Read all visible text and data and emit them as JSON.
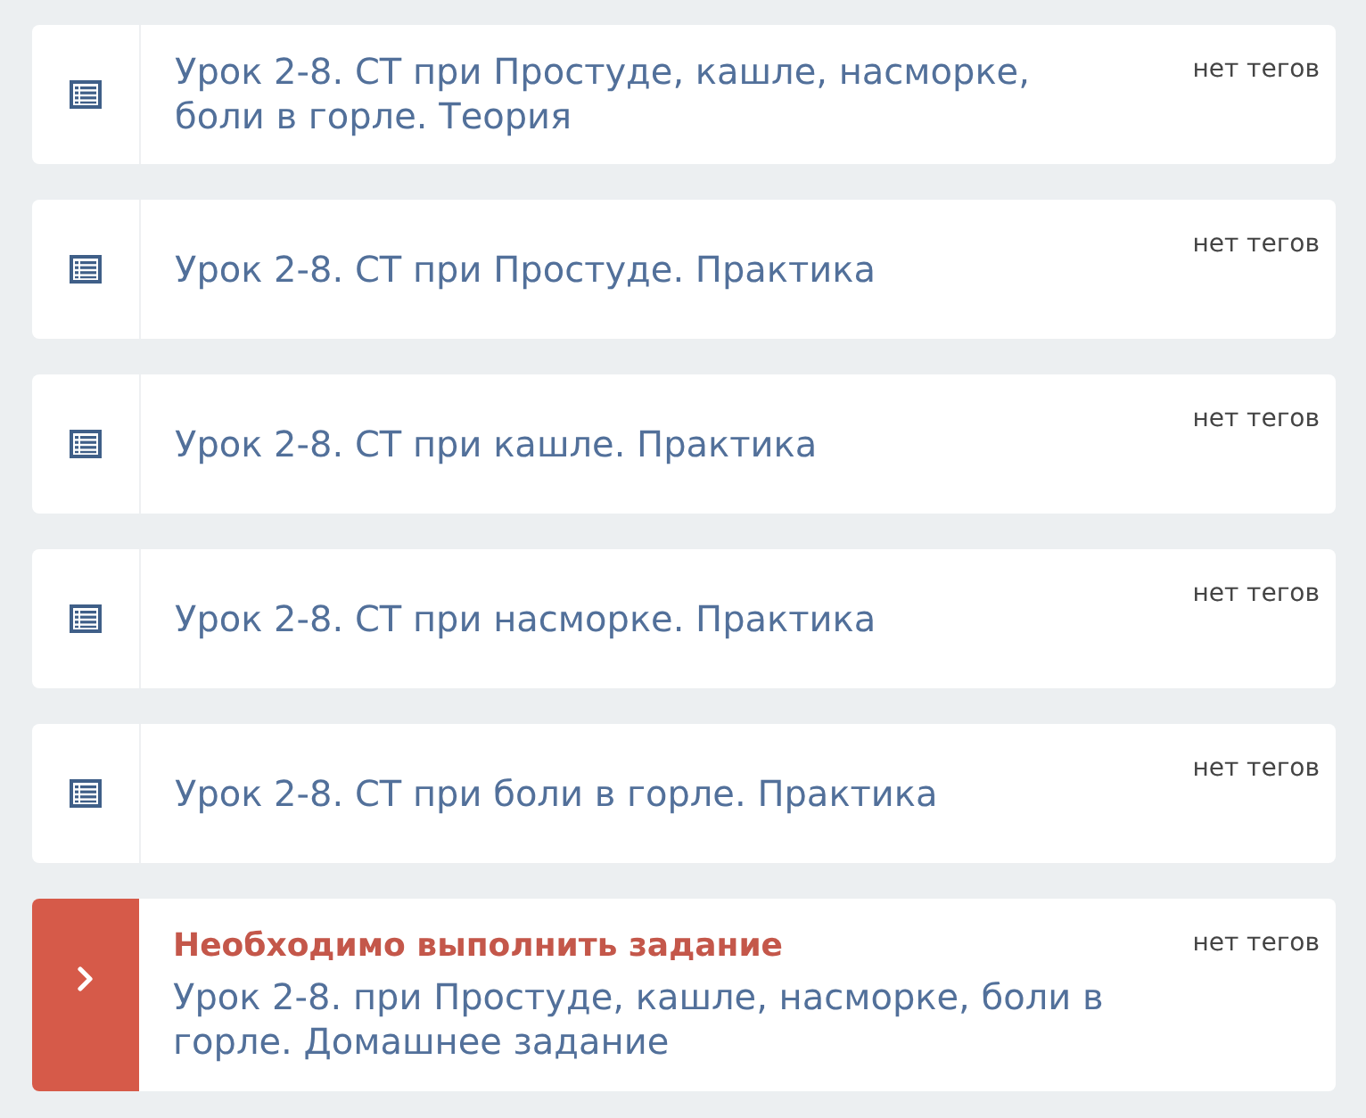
{
  "lessons": [
    {
      "kind": "lesson",
      "title": "Урок 2-8. СТ при Простуде, кашле, насморке, боли в горле. Теория",
      "tags": "нет тегов"
    },
    {
      "kind": "lesson",
      "title": "Урок 2-8. СТ при Простуде. Практика",
      "tags": "нет тегов"
    },
    {
      "kind": "lesson",
      "title": "Урок 2-8. СТ при кашле. Практика",
      "tags": "нет тегов"
    },
    {
      "kind": "lesson",
      "title": "Урок 2-8. СТ при насморке. Практика",
      "tags": "нет тегов"
    },
    {
      "kind": "lesson",
      "title": "Урок 2-8. СТ при боли в горле. Практика",
      "tags": "нет тегов"
    },
    {
      "kind": "assignment",
      "notice": "Необходимо выполнить задание",
      "title": "Урок 2-8. при Простуде, кашле, насморке, боли в горле. Домашнее задание",
      "tags": "нет тегов"
    }
  ]
}
